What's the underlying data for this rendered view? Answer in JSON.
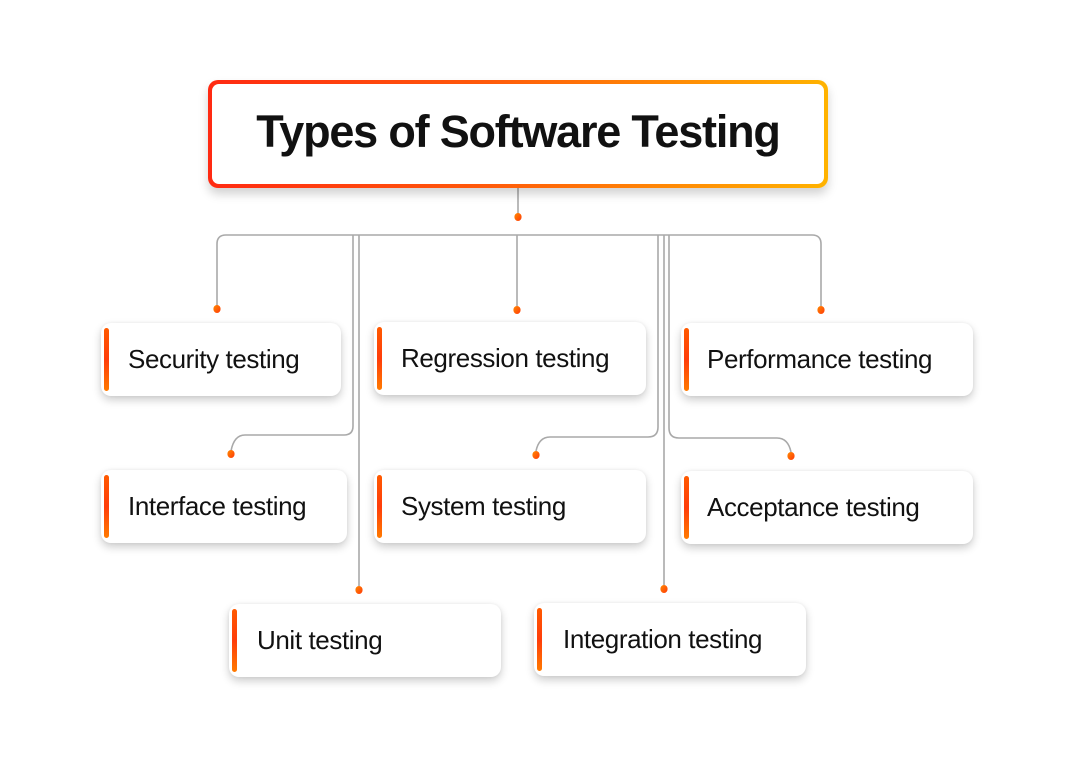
{
  "title": "Types of Software Testing",
  "colors": {
    "title_gradient_start": "#ff2a12",
    "title_gradient_end": "#ffb300",
    "accent": "#ff4d05",
    "connector": "#a9a9a9",
    "text": "#111111",
    "background": "#ffffff"
  },
  "testing_types": [
    {
      "id": "security",
      "label": "Security testing",
      "row": 1,
      "column": 1
    },
    {
      "id": "regression",
      "label": "Regression testing",
      "row": 1,
      "column": 2
    },
    {
      "id": "performance",
      "label": "Performance testing",
      "row": 1,
      "column": 3
    },
    {
      "id": "interface",
      "label": "Interface testing",
      "row": 2,
      "column": 1
    },
    {
      "id": "system",
      "label": "System testing",
      "row": 2,
      "column": 2
    },
    {
      "id": "acceptance",
      "label": "Acceptance testing",
      "row": 2,
      "column": 3
    },
    {
      "id": "unit",
      "label": "Unit testing",
      "row": 3,
      "column": 1
    },
    {
      "id": "integration",
      "label": "Integration testing",
      "row": 3,
      "column": 2
    }
  ]
}
